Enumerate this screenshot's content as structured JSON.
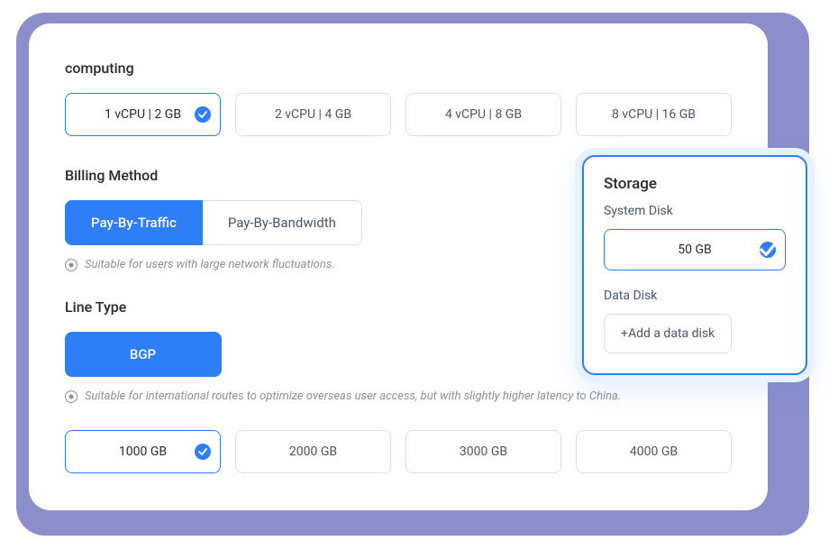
{
  "computing": {
    "title": "computing",
    "options": [
      {
        "label": "1 vCPU | 2 GB",
        "selected": true
      },
      {
        "label": "2 vCPU | 4 GB",
        "selected": false
      },
      {
        "label": "4 vCPU | 8 GB",
        "selected": false
      },
      {
        "label": "8 vCPU | 16 GB",
        "selected": false
      }
    ]
  },
  "billing": {
    "title": "Billing Method",
    "options": [
      {
        "label": "Pay-By-Traffic",
        "active": true
      },
      {
        "label": "Pay-By-Bandwidth",
        "active": false
      }
    ],
    "hint": "Suitable for users with large network fluctuations."
  },
  "line": {
    "title": "Line Type",
    "option": "BGP",
    "hint": "Suitable for international routes to optimize overseas user access, but with slightly higher latency to China."
  },
  "bandwidth": {
    "options": [
      {
        "label": "1000 GB",
        "selected": true
      },
      {
        "label": "2000 GB",
        "selected": false
      },
      {
        "label": "3000 GB",
        "selected": false
      },
      {
        "label": "4000 GB",
        "selected": false
      }
    ]
  },
  "storage": {
    "title": "Storage",
    "system_label": "System Disk",
    "system_value": "50 GB",
    "data_label": "Data Disk",
    "add_label": "+Add a data disk"
  }
}
